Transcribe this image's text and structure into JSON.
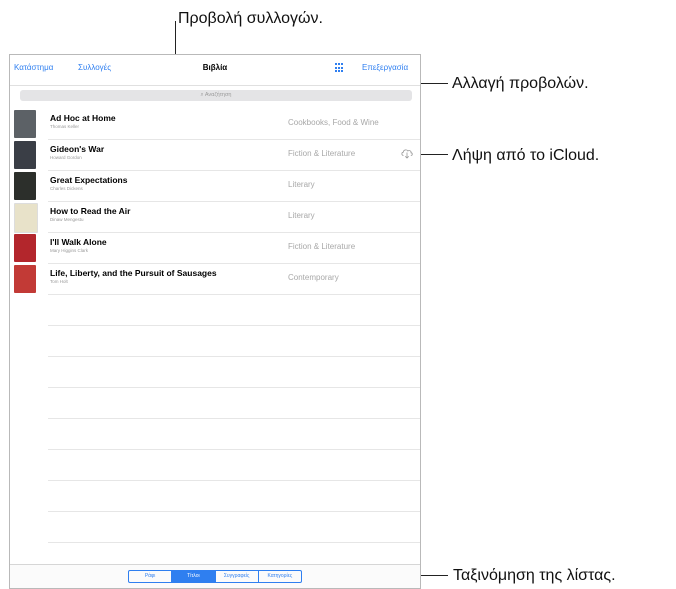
{
  "callouts": {
    "collections_view": "Προβολή συλλογών.",
    "change_views": "Αλλαγή προβολών.",
    "icloud_download": "Λήψη από το iCloud.",
    "sort_list": "Ταξινόμηση της λίστας."
  },
  "navbar": {
    "store": "Κατάστημα",
    "collections": "Συλλογές",
    "title": "Βιβλία",
    "edit": "Επεξεργασία"
  },
  "search": {
    "placeholder": "Αναζήτηση"
  },
  "books": [
    {
      "title": "Ad Hoc at Home",
      "author": "Thomas Keller",
      "category": "Cookbooks, Food & Wine",
      "cover_color": "#5c6166"
    },
    {
      "title": "Gideon's War",
      "author": "Howard Gordon",
      "category": "Fiction & Literature",
      "cover_color": "#3a3e46",
      "icloud": true
    },
    {
      "title": "Great Expectations",
      "author": "Charles Dickens",
      "category": "Literary",
      "cover_color": "#2c2f2b"
    },
    {
      "title": "How to Read the Air",
      "author": "Dinaw Mengestu",
      "category": "Literary",
      "cover_color": "#e8e2c9"
    },
    {
      "title": "I'll Walk Alone",
      "author": "Mary Higgins Clark",
      "category": "Fiction & Literature",
      "cover_color": "#b3262c"
    },
    {
      "title": "Life, Liberty, and the Pursuit of Sausages",
      "author": "Tom Holt",
      "category": "Contemporary",
      "cover_color": "#c23a36"
    }
  ],
  "sort_segments": [
    {
      "label": "Ράφι",
      "active": false
    },
    {
      "label": "Τίτλοι",
      "active": true
    },
    {
      "label": "Συγγραφείς",
      "active": false
    },
    {
      "label": "Κατηγορίες",
      "active": false
    }
  ],
  "colors": {
    "accent": "#2f7ff0"
  }
}
